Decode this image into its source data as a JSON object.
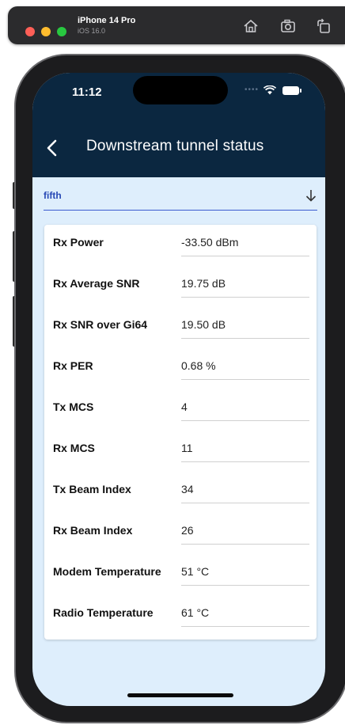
{
  "simulator": {
    "device_name": "iPhone 14 Pro",
    "os_version": "iOS 16.0"
  },
  "status_bar": {
    "time": "11:12"
  },
  "app_bar": {
    "title": "Downstream tunnel status"
  },
  "selector": {
    "value": "fifth"
  },
  "metrics": [
    {
      "label": "Rx Power",
      "value": "-33.50 dBm"
    },
    {
      "label": "Rx Average SNR",
      "value": "19.75 dB"
    },
    {
      "label": "Rx SNR over Gi64",
      "value": "19.50 dB"
    },
    {
      "label": "Rx PER",
      "value": "0.68 %"
    },
    {
      "label": "Tx MCS",
      "value": "4"
    },
    {
      "label": "Rx MCS",
      "value": "11"
    },
    {
      "label": "Tx Beam Index",
      "value": "34"
    },
    {
      "label": "Rx Beam Index",
      "value": "26"
    },
    {
      "label": "Modem Temperature",
      "value": "51 °C"
    },
    {
      "label": "Radio Temperature",
      "value": "61 °C"
    }
  ],
  "colors": {
    "app_bar": "#0b2740",
    "background": "#deeefc",
    "accent": "#2748b5"
  },
  "icons": {
    "sim_home": "home-icon",
    "sim_screenshot": "screenshot-icon",
    "sim_rotate": "rotate-icon",
    "back": "chevron-left-icon",
    "dropdown": "arrow-down-icon"
  }
}
